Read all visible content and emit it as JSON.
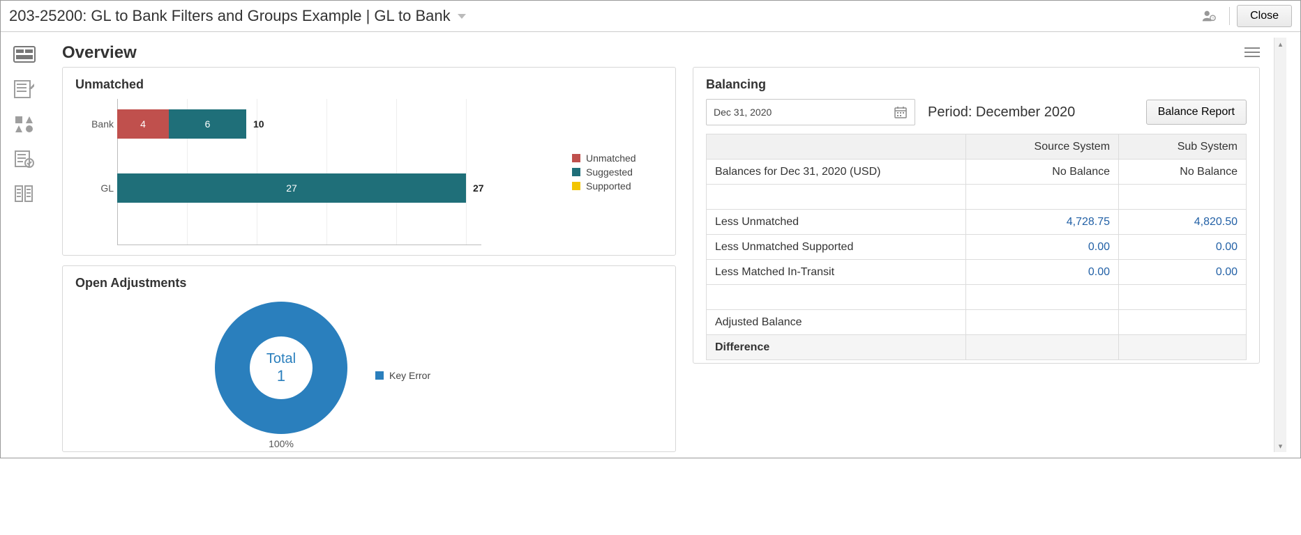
{
  "header": {
    "title_full": "203-25200: GL to Bank Filters and Groups Example | GL to Bank",
    "close": "Close"
  },
  "overview_label": "Overview",
  "unmatched": {
    "title": "Unmatched",
    "legend": {
      "unmatched": "Unmatched",
      "suggested": "Suggested",
      "supported": "Supported"
    }
  },
  "open_adj": {
    "title": "Open Adjustments",
    "center_label": "Total",
    "center_value": "1",
    "percent": "100%",
    "legend": "Key Error"
  },
  "balancing": {
    "title": "Balancing",
    "date": "Dec 31, 2020",
    "period": "Period: December 2020",
    "report_btn": "Balance Report",
    "head_col1": "",
    "head_source": "Source System",
    "head_sub": "Sub System",
    "rows": {
      "balances_label": "Balances for Dec 31, 2020 (USD)",
      "balances_source": "No Balance",
      "balances_sub": "No Balance",
      "less_unmatched": "Less Unmatched",
      "less_unmatched_src": "4,728.75",
      "less_unmatched_sub": "4,820.50",
      "less_supported": "Less Unmatched Supported",
      "less_supported_src": "0.00",
      "less_supported_sub": "0.00",
      "less_transit": "Less Matched In-Transit",
      "less_transit_src": "0.00",
      "less_transit_sub": "0.00",
      "adjusted": "Adjusted Balance",
      "difference": "Difference"
    }
  },
  "chart_data": [
    {
      "type": "bar",
      "orientation": "horizontal",
      "stacked": true,
      "title": "Unmatched",
      "categories": [
        "Bank",
        "GL"
      ],
      "series": [
        {
          "name": "Unmatched",
          "values": [
            4,
            0
          ],
          "color": "#c0504d"
        },
        {
          "name": "Suggested",
          "values": [
            6,
            27
          ],
          "color": "#1f6f79"
        },
        {
          "name": "Supported",
          "values": [
            0,
            0
          ],
          "color": "#f2c500"
        }
      ],
      "totals": [
        10,
        27
      ],
      "xlim": [
        0,
        30
      ]
    },
    {
      "type": "pie",
      "title": "Open Adjustments",
      "series": [
        {
          "name": "Key Error",
          "value": 1,
          "percent": 100,
          "color": "#2a7fbd"
        }
      ],
      "center_label": "Total",
      "center_value": 1
    }
  ]
}
